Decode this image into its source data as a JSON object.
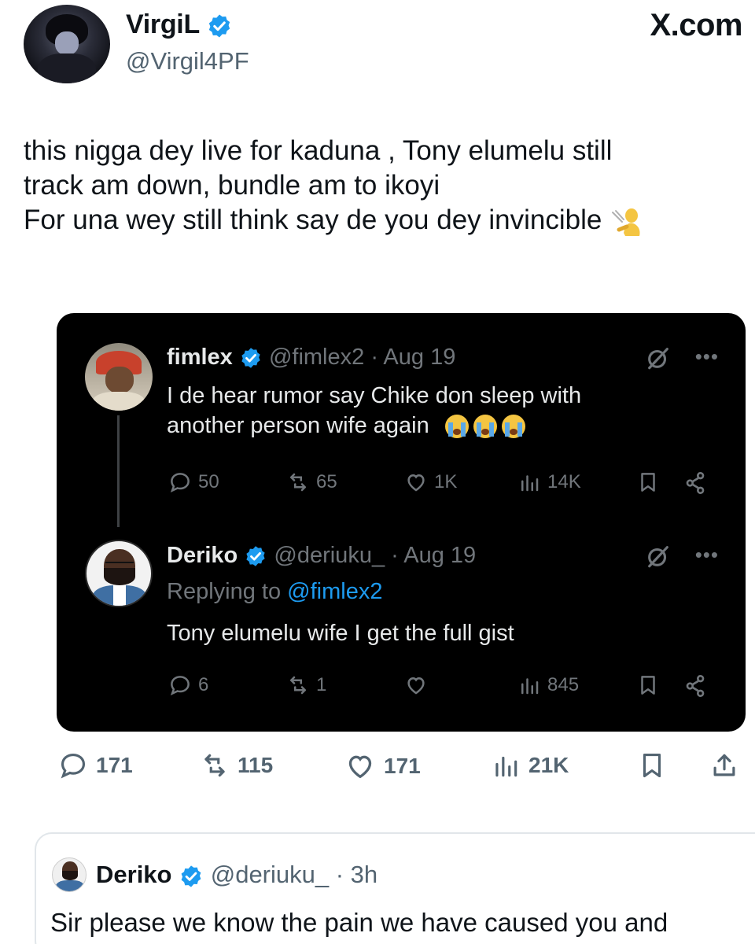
{
  "header": {
    "name": "VirgiL",
    "handle": "@Virgil4PF",
    "site": "X.com"
  },
  "tweet": {
    "lines": [
      "this nigga dey live for kaduna , Tony elumelu still",
      "track am down, bundle am to ikoyi",
      "For una wey still think say de you dey invincible"
    ],
    "trailing_emoji": "hand-pointing-emoji"
  },
  "embedded": {
    "first": {
      "name": "fimlex",
      "handle": "@fimlex2",
      "date": "· Aug 19",
      "lines": [
        "I de hear rumor say Chike don sleep with",
        "another person wife again"
      ],
      "emoji": "crying-face-emoji x3",
      "replies": "50",
      "reposts": "65",
      "likes": "1K",
      "views": "14K"
    },
    "second": {
      "name": "Deriko",
      "handle": "@deriuku_",
      "date": "· Aug 19",
      "replying_prefix": "Replying to",
      "replying_to": "@fimlex2",
      "text": "Tony elumelu wife I get the full gist",
      "replies": "6",
      "reposts": "1",
      "likes": "",
      "views": "845"
    }
  },
  "stats": {
    "replies": "171",
    "reposts": "115",
    "likes": "171",
    "views": "21K"
  },
  "reply_card": {
    "name": "Deriko",
    "handle": "@deriuku_",
    "time": "· 3h",
    "text": "Sir please we know the pain we have caused you and"
  },
  "colors": {
    "verified": "#1d9bf0",
    "text": "#0f1419",
    "muted": "#536471",
    "embed_bg": "#000000",
    "link": "#1d9bf0"
  }
}
